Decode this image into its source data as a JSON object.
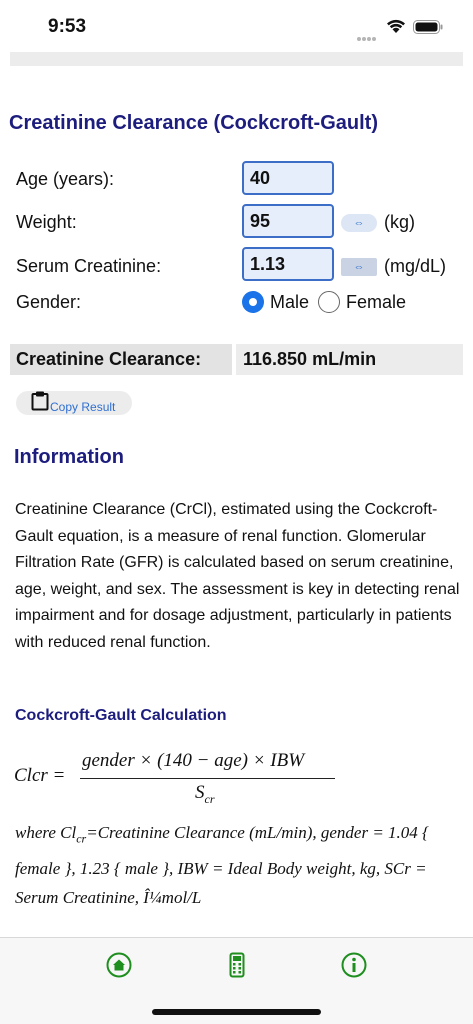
{
  "status_bar": {
    "time": "9:53"
  },
  "calculator": {
    "title": "Creatinine Clearance (Cockcroft-Gault)",
    "age_label": "Age (years):",
    "age_value": "40",
    "weight_label": "Weight:",
    "weight_value": "95",
    "weight_unit": "(kg)",
    "creatinine_label": "Serum Creatinine:",
    "creatinine_value": "1.13",
    "creatinine_unit": "(mg/dL)",
    "unit_toggle_glyph": "⇔",
    "gender_label": "Gender:",
    "gender_options": [
      "Male",
      "Female"
    ],
    "gender_selected": "Male",
    "result_label": "Creatinine Clearance:",
    "result_value": "116.850 mL/min",
    "copy_label": "Copy Result"
  },
  "info": {
    "heading": "Information",
    "paragraph": "Creatinine Clearance (CrCl), estimated using the Cockcroft-Gault equation, is a measure of renal function. Glomerular Filtration Rate (GFR) is calculated based on serum creatinine, age, weight, and sex. The assessment is key in detecting renal impairment and for dosage adjustment, particularly in patients with reduced renal function.",
    "calc_heading": "Cockcroft-Gault Calculation",
    "formula_lhs": "Clcr =",
    "formula_numerator": "gender × (140 − age) × IBW",
    "formula_denominator": "S",
    "formula_denominator_sub": "cr",
    "where_prefix": "where Cl",
    "where_sub": "cr",
    "where_rest": "=Creatinine Clearance (mL/min), gender = 1.04 { female }, 1.23 { male }, IBW = Ideal Body weight, kg, SCr = Serum Creatinine, Î¼mol/L"
  },
  "tab_bar": {
    "items": [
      "home-icon",
      "calculator-icon",
      "info-icon"
    ],
    "accent": "#1e8e1e"
  },
  "colors": {
    "heading": "#1d1d7e",
    "input_border": "#3c6ec8",
    "radio": "#1a73e8",
    "link": "#2f6fd0"
  }
}
